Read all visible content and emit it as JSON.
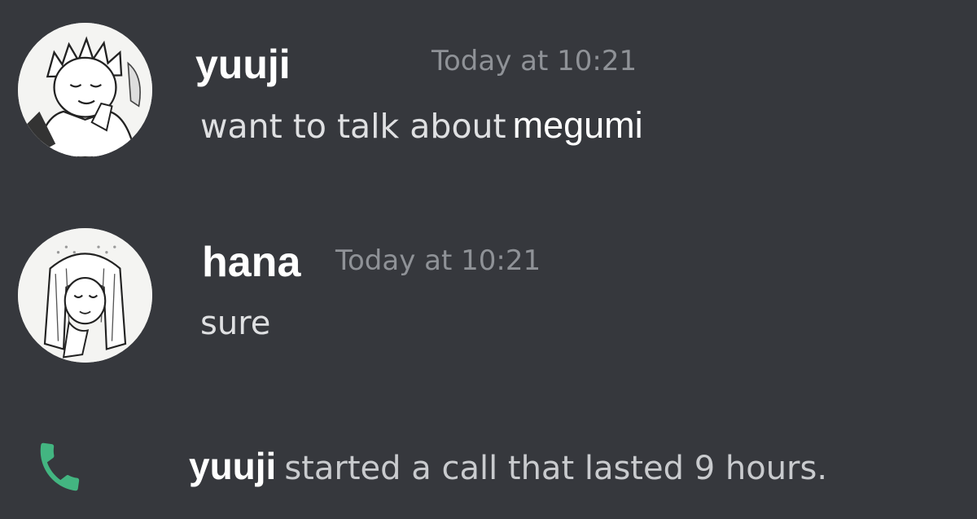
{
  "messages": [
    {
      "author": "yuuji",
      "timestamp": "Today at 10:21",
      "content_prefix": "want to talk about",
      "content_added": "megumi",
      "avatar_icon": "manga-character-avatar"
    },
    {
      "author": "hana",
      "timestamp": "Today at 10:21",
      "content": "sure",
      "avatar_icon": "manga-character-avatar"
    }
  ],
  "call": {
    "author": "yuuji",
    "description": "started a call that lasted 9 hours.",
    "icon": "phone-icon",
    "icon_color": "#43b581"
  },
  "colors": {
    "background": "#36383d",
    "author": "#ffffff",
    "timestamp": "#8f9297",
    "message_text": "#dfe0e2"
  }
}
